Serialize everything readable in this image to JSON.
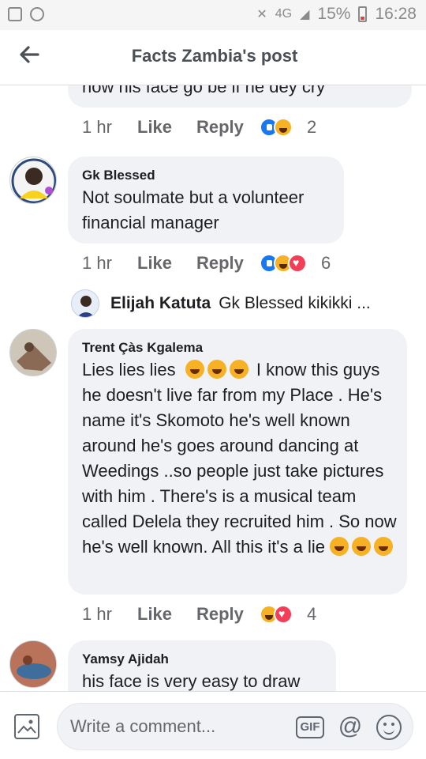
{
  "status_bar": {
    "network": "4G",
    "battery": "15%",
    "time": "16:28"
  },
  "header": {
    "title": "Facts Zambia's post"
  },
  "comments": [
    {
      "text": "now his face go be if he dey cry",
      "time": "1 hr",
      "like_label": "Like",
      "reply_label": "Reply",
      "reactions": [
        "like",
        "haha"
      ],
      "reaction_count": "2"
    },
    {
      "author": "Gk Blessed",
      "text": "Not soulmate but a volunteer financial manager",
      "time": "1 hr",
      "like_label": "Like",
      "reply_label": "Reply",
      "reactions": [
        "like",
        "haha",
        "love"
      ],
      "reaction_count": "6",
      "reply_preview": {
        "author": "Elijah Katuta",
        "text": "Gk Blessed kikikki ..."
      }
    },
    {
      "author": "Trent Çàs Kgalema",
      "text_start": "Lies lies lies",
      "text_middle": " I know this guys he doesn't live far from my Place . He's name it's Skomoto he's well known around he's goes around dancing at Weedings ..so people just take pictures with him . There's is a musical team called Delela they recruited him . So now he's well known. All this it's a lie ",
      "time": "1 hr",
      "like_label": "Like",
      "reply_label": "Reply",
      "reactions": [
        "haha",
        "love"
      ],
      "reaction_count": "4"
    },
    {
      "author": "Yamsy Ajidah",
      "text": "his face is very easy to draw"
    }
  ],
  "composer": {
    "placeholder": "Write a comment...",
    "gif_label": "GIF",
    "at_label": "@"
  }
}
